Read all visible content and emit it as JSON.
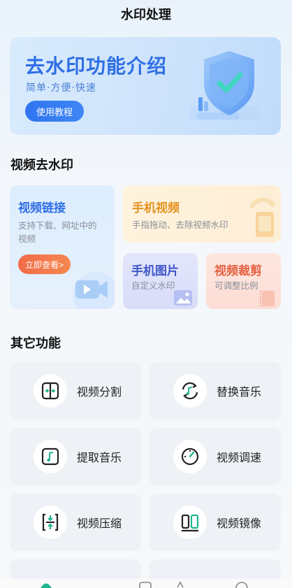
{
  "header": {
    "title": "水印处理"
  },
  "banner": {
    "title": "去水印功能介绍",
    "subtitle": "简单·方便·快速",
    "button": "使用教程"
  },
  "video_section": {
    "title": "视频去水印",
    "cards": {
      "link": {
        "title": "视频链接",
        "desc": "支持下载、网址中的视频",
        "button": "立即查看>"
      },
      "phone_video": {
        "title": "手机视频",
        "desc": "手指拖动、去除视频水印"
      },
      "phone_image": {
        "title": "手机图片",
        "desc": "自定义水印"
      },
      "crop": {
        "title": "视频裁剪",
        "desc": "可调整比例"
      }
    }
  },
  "other_section": {
    "title": "其它功能",
    "items": [
      {
        "label": "视频分割",
        "icon": "split-icon"
      },
      {
        "label": "替换音乐",
        "icon": "replace-music-icon"
      },
      {
        "label": "提取音乐",
        "icon": "extract-music-icon"
      },
      {
        "label": "视频调速",
        "icon": "speed-icon"
      },
      {
        "label": "视频压缩",
        "icon": "compress-icon"
      },
      {
        "label": "视频镜像",
        "icon": "mirror-icon"
      }
    ]
  },
  "colors": {
    "accent_blue": "#2f6fe6",
    "accent_orange": "#f36b4a",
    "icon_green": "#1fb58f"
  }
}
